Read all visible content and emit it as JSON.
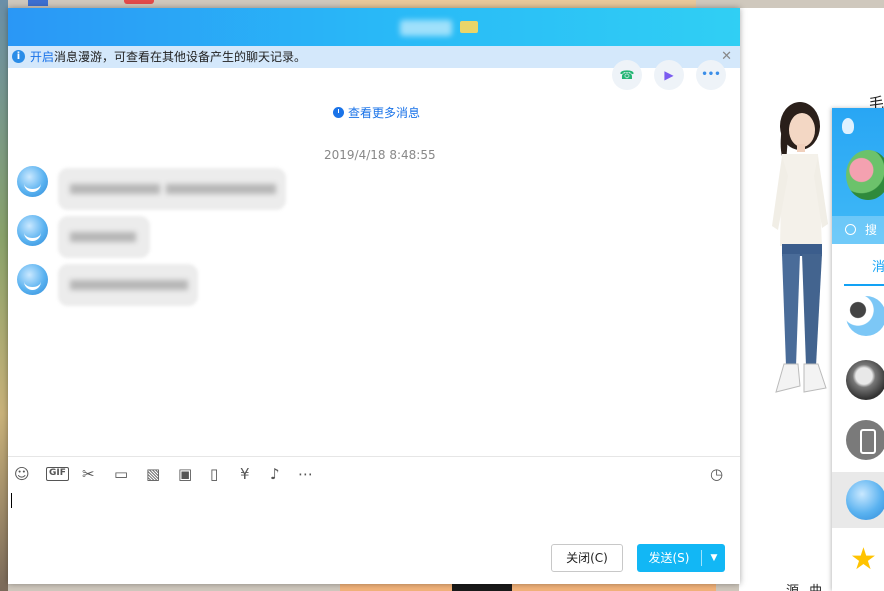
{
  "window": {
    "controls": {
      "minimize_dropdown": "⌵",
      "minimize": "—",
      "maximize": "☐",
      "close": "✕"
    }
  },
  "notice": {
    "link_text": "开启",
    "text": "消息漫游，可查看在其他设备产生的聊天记录。",
    "close": "✕"
  },
  "actions": {
    "phone": "☎",
    "video": "▶",
    "more": "•••"
  },
  "history": {
    "more_messages": "查看更多消息",
    "timestamp": "2019/4/18 8:48:55"
  },
  "toolbar": {
    "emoji": "☺",
    "gif": "GIF",
    "screenshot": "✂",
    "file": "▭",
    "sticker": "▧",
    "image": "▣",
    "shake": "▯",
    "redpacket": "¥",
    "music": "♪",
    "more": "⋯",
    "history": "◷"
  },
  "buttons": {
    "close": "关闭(C)",
    "send": "发送(S)",
    "send_dropdown": "▼"
  },
  "qq_panel": {
    "search": "搜索",
    "tab_messages": "消"
  },
  "right_pane": {
    "char": "毛",
    "bottom": "源 曲 求"
  },
  "colors": {
    "accent": "#12b7f5",
    "link": "#1a73e8",
    "title_gradient_start": "#2a97f6",
    "title_gradient_end": "#30cff4"
  }
}
